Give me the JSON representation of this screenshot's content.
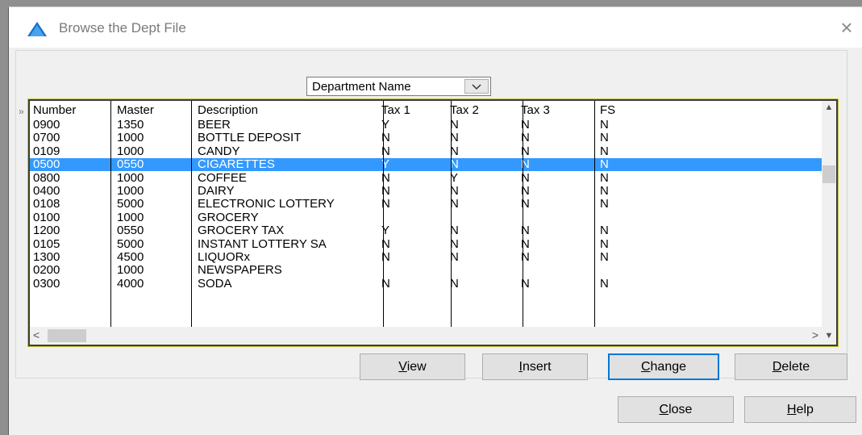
{
  "window": {
    "title": "Browse the Dept File",
    "close_glyph": "×"
  },
  "sort_combo": {
    "value": "Department Name"
  },
  "grid": {
    "columns": [
      "Number",
      "Master",
      "Description",
      "Tax 1",
      "Tax 2",
      "Tax 3",
      "FS"
    ],
    "rows": [
      [
        "0900",
        "1350",
        "BEER",
        "Y",
        "N",
        "N",
        "N"
      ],
      [
        "0700",
        "1000",
        "BOTTLE DEPOSIT",
        "N",
        "N",
        "N",
        "N"
      ],
      [
        "0109",
        "1000",
        "CANDY",
        "N",
        "N",
        "N",
        "N"
      ],
      [
        "0500",
        "0550",
        "CIGARETTES",
        "Y",
        "N",
        "N",
        "N"
      ],
      [
        "0800",
        "1000",
        "COFFEE",
        "N",
        "Y",
        "N",
        "N"
      ],
      [
        "0400",
        "1000",
        "DAIRY",
        "N",
        "N",
        "N",
        "N"
      ],
      [
        "0108",
        "5000",
        "ELECTRONIC LOTTERY",
        "N",
        "N",
        "N",
        "N"
      ],
      [
        "0100",
        "1000",
        "GROCERY",
        "",
        "",
        "",
        ""
      ],
      [
        "1200",
        "0550",
        "GROCERY TAX",
        "Y",
        "N",
        "N",
        "N"
      ],
      [
        "0105",
        "5000",
        "INSTANT LOTTERY SA",
        "N",
        "N",
        "N",
        "N"
      ],
      [
        "1300",
        "4500",
        "LIQUORx",
        "N",
        "N",
        "N",
        "N"
      ],
      [
        "0200",
        "1000",
        "NEWSPAPERS",
        "",
        "",
        "",
        ""
      ],
      [
        "0300",
        "4000",
        "SODA",
        "N",
        "N",
        "N",
        "N"
      ]
    ],
    "selected_row_index": 3
  },
  "buttons": {
    "view": {
      "accel": "V",
      "rest": "iew"
    },
    "insert": {
      "accel": "I",
      "rest": "nsert"
    },
    "change": {
      "accel": "C",
      "rest": "hange"
    },
    "delete": {
      "accel": "D",
      "rest": "elete"
    },
    "close": {
      "accel": "C",
      "rest": "lose"
    },
    "help": {
      "accel": "H",
      "rest": "elp"
    }
  },
  "colors": {
    "selection": "#3399ff",
    "title_icon": "#1a73c8",
    "default_button_border": "#0078d7"
  },
  "icons": {
    "app": "triangle-app-icon",
    "close": "close-icon",
    "dropdown": "chevron-down-icon",
    "row_marker": "double-chevron-right-icon"
  }
}
